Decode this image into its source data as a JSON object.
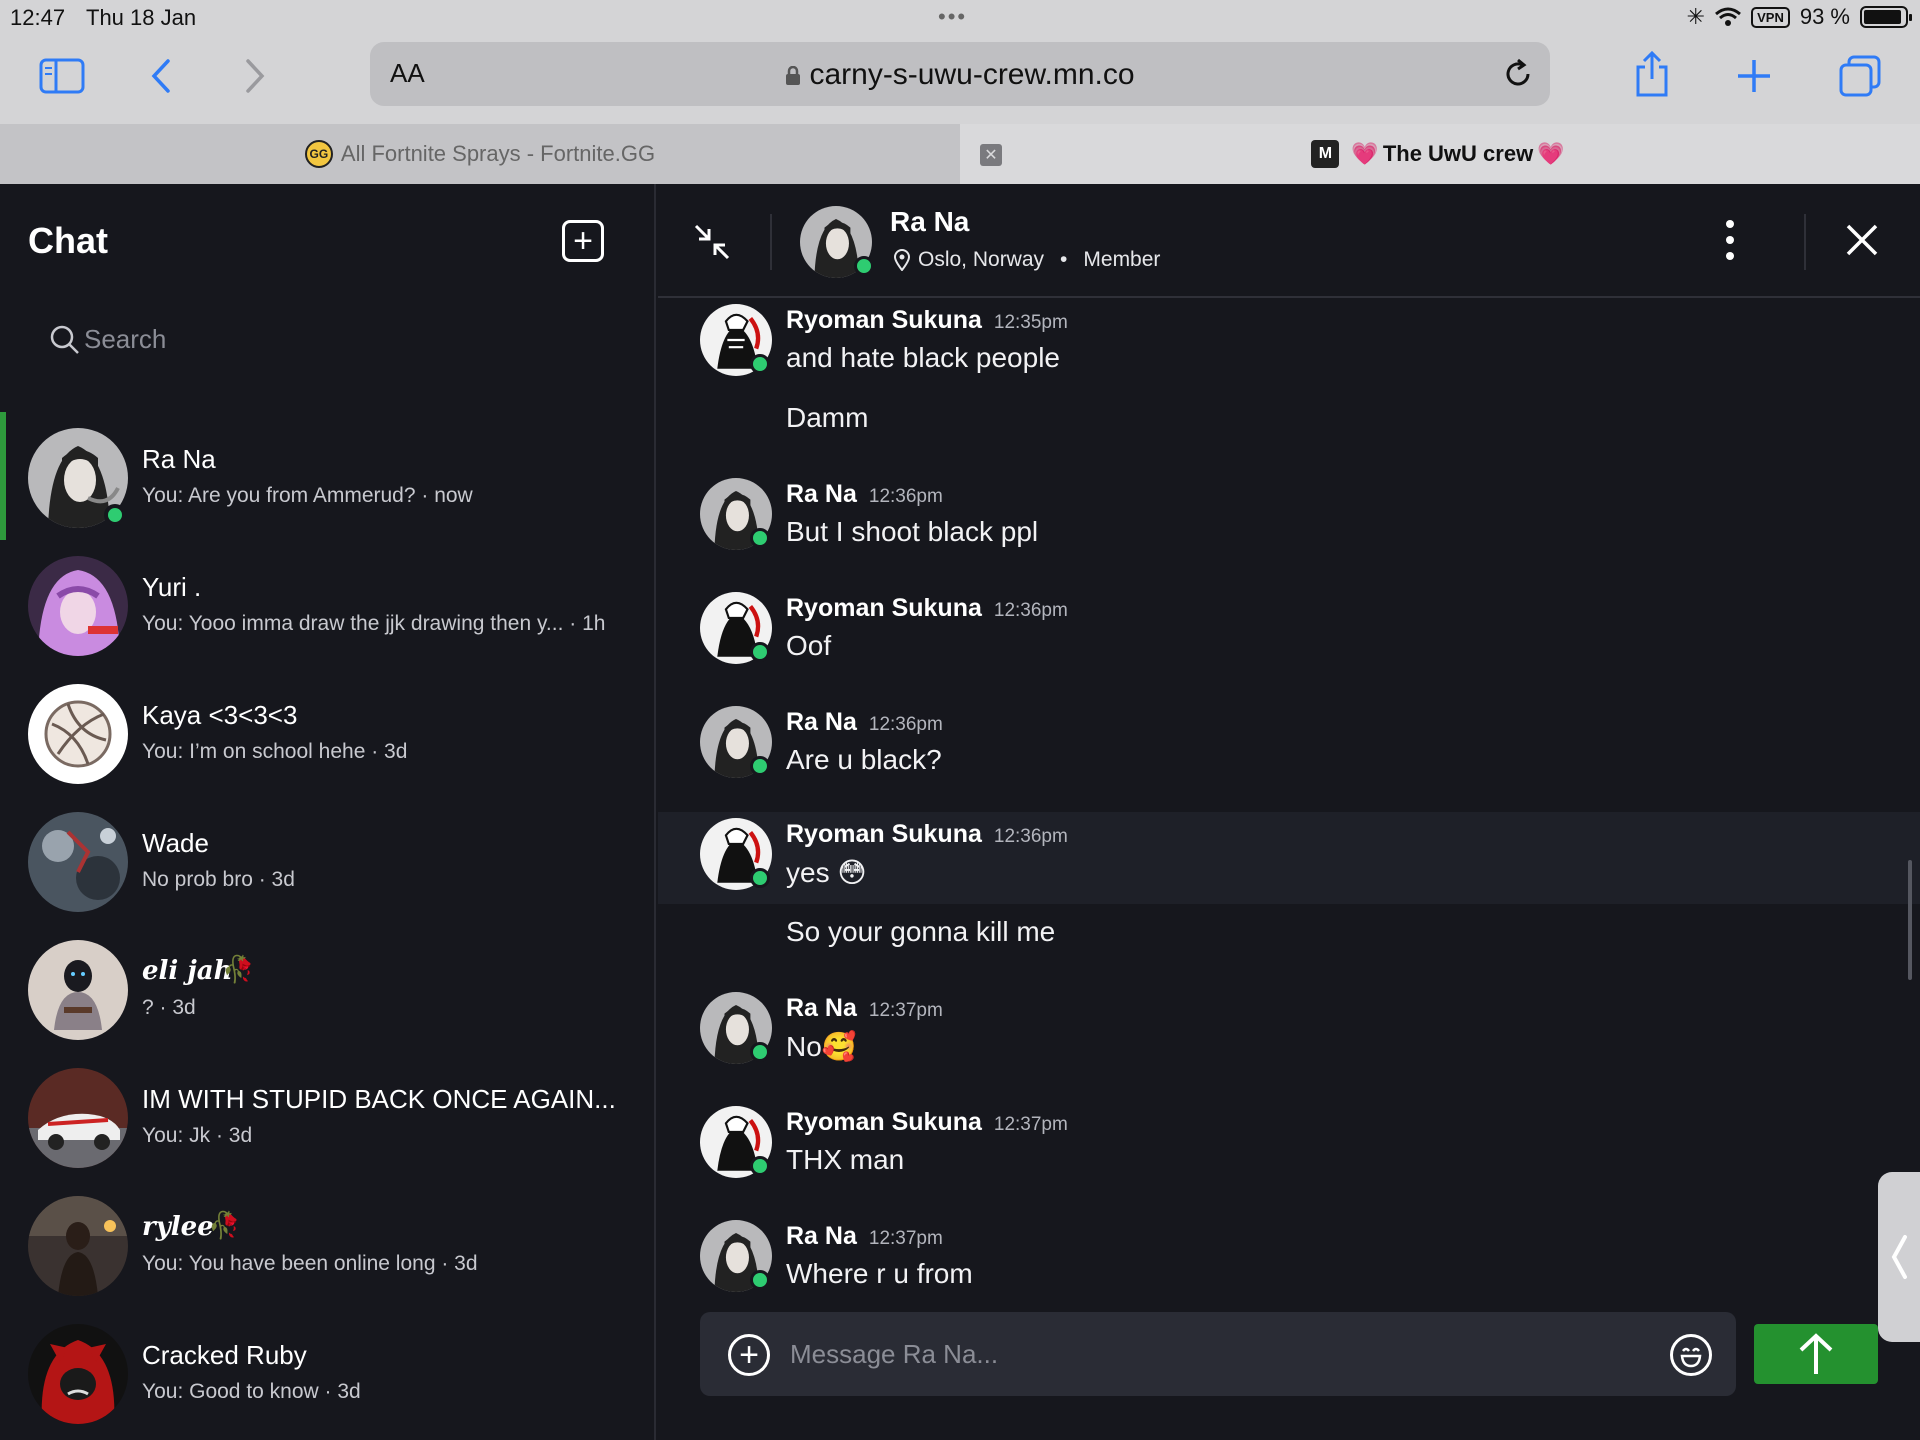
{
  "status_bar": {
    "time": "12:47",
    "date": "Thu 18 Jan",
    "vpn": "VPN",
    "battery": "93 %",
    "battery_level": 0.93
  },
  "browser": {
    "aa_label": "AA",
    "url": "carny-s-uwu-crew.mn.co",
    "tabs": [
      {
        "title": "All Fortnite Sprays - Fortnite.GG",
        "favicon": "GG",
        "active": false
      },
      {
        "title": "The UwU crew",
        "favicon": "M",
        "active": true
      }
    ]
  },
  "sidebar": {
    "title": "Chat",
    "search_placeholder": "Search",
    "chats": [
      {
        "name": "Ra Na",
        "preview": "You: Are you from Ammerud? · now",
        "online": true,
        "avatar_color": "#6b6d70"
      },
      {
        "name": "Yuri .",
        "preview": "You: Yooo imma draw the jjk drawing then y... · 1h",
        "online": false,
        "avatar_color": "#b06fc4"
      },
      {
        "name": "Kaya <3<3<3",
        "preview": "You: I’m on school hehe · 3d",
        "online": false,
        "avatar_color": "#ffffff"
      },
      {
        "name": "Wade",
        "preview": "No prob bro · 3d",
        "online": false,
        "avatar_color": "#5a6470"
      },
      {
        "name": "eli jah",
        "preview": "? · 3d",
        "online": false,
        "avatar_color": "#8a7f78"
      },
      {
        "name": "IM WITH STUPID BACK ONCE AGAIN...",
        "preview": "You: Jk · 3d",
        "online": false,
        "avatar_color": "#8a4a40"
      },
      {
        "name": "rylee",
        "preview": "You: You have been online long · 3d",
        "online": false,
        "avatar_color": "#4a3a30"
      },
      {
        "name": "Cracked Ruby",
        "preview": "You: Good to know · 3d",
        "online": false,
        "avatar_color": "#b01515"
      }
    ]
  },
  "conversation": {
    "contact_name": "Ra Na",
    "location": "Oslo, Norway",
    "role": "Member",
    "messages": [
      {
        "author": "Ryoman Sukuna",
        "time": "12:35pm",
        "lines": [
          "and hate black people",
          "Damm"
        ]
      },
      {
        "author": "Ra Na",
        "time": "12:36pm",
        "lines": [
          "But I shoot black ppl"
        ]
      },
      {
        "author": "Ryoman Sukuna",
        "time": "12:36pm",
        "lines": [
          "Oof"
        ]
      },
      {
        "author": "Ra Na",
        "time": "12:36pm",
        "lines": [
          "Are u black?"
        ]
      },
      {
        "author": "Ryoman Sukuna",
        "time": "12:36pm",
        "lines": [
          "yes 😳",
          "So your gonna kill me"
        ]
      },
      {
        "author": "Ra Na",
        "time": "12:37pm",
        "lines": [
          "No🥰"
        ]
      },
      {
        "author": "Ryoman Sukuna",
        "time": "12:37pm",
        "lines": [
          "THX man"
        ]
      },
      {
        "author": "Ra Na",
        "time": "12:37pm",
        "lines": [
          "Where r u from"
        ]
      }
    ],
    "composer_placeholder": "Message Ra Na..."
  },
  "colors": {
    "background": "#16171d",
    "accent_green": "#24912f",
    "online": "#2ecc71",
    "active_indicator": "#2e9a3c"
  },
  "icons": [
    "sidebar-icon",
    "back-icon",
    "forward-icon",
    "lock-icon",
    "reload-icon",
    "share-icon",
    "new-tab-icon",
    "tabs-icon",
    "compose-icon",
    "search-icon",
    "collapse-icon",
    "location-pin-icon",
    "more-icon",
    "close-icon",
    "add-icon",
    "emoji-icon",
    "send-arrow-icon"
  ]
}
